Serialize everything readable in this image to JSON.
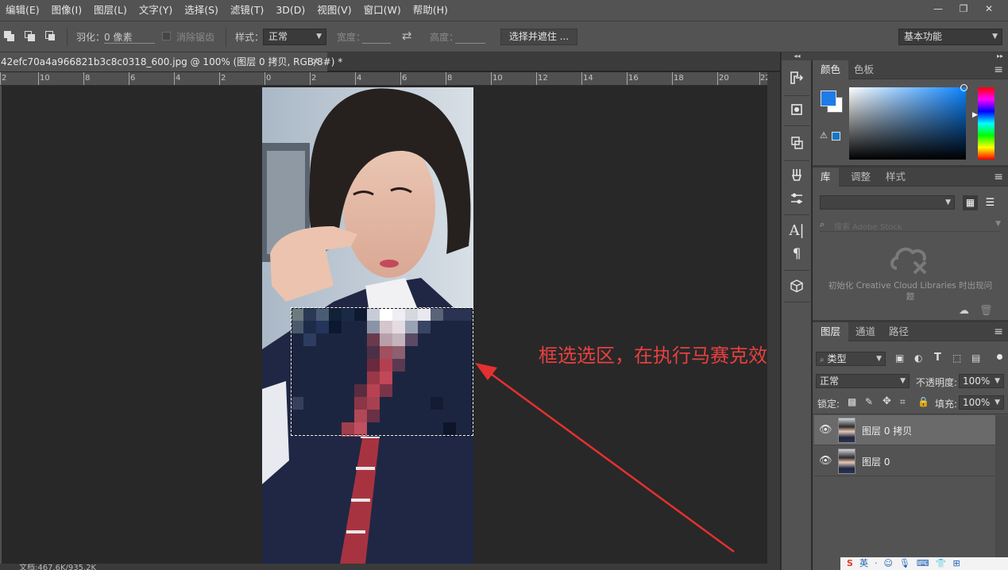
{
  "menubar": {
    "items": [
      "编辑(E)",
      "图像(I)",
      "图层(L)",
      "文字(Y)",
      "选择(S)",
      "滤镜(T)",
      "3D(D)",
      "视图(V)",
      "窗口(W)",
      "帮助(H)"
    ],
    "minimize": "—",
    "restore": "❐",
    "close": "✕"
  },
  "options": {
    "feather_label": "羽化：",
    "feather_value": "0 像素",
    "antialias_label": "消除锯齿",
    "style_label": "样式：",
    "style_value": "正常",
    "width_label": "宽度：",
    "swap_icon": "⇄",
    "height_label": "高度：",
    "select_mask_button": "选择并遮住 ...",
    "workspace_value": "基本功能"
  },
  "document": {
    "tab_title": "42efc70a4a966821b3c8c0318_600.jpg @ 100% (图层 0 拷贝, RGB/8#) *",
    "close": "✕",
    "ruler_numbers": [
      "2",
      "10",
      "8",
      "6",
      "4",
      "2",
      "0",
      "2",
      "4",
      "6",
      "8",
      "10",
      "12",
      "14",
      "16",
      "18",
      "20",
      "22"
    ],
    "annotation": "框选选区，在执行马赛克效果",
    "status_text": "文档:467.6K/935.2K"
  },
  "panels": {
    "collapse": "◂◂",
    "color_tabs": [
      "颜色",
      "色板"
    ],
    "library_tabs": [
      "库",
      "调整",
      "样式"
    ],
    "stock_placeholder": "搜索 Adobe Stock",
    "cc_message": "初始化 Creative Cloud Libraries 时出现问题",
    "layers_tabs": [
      "图层",
      "通道",
      "路径"
    ],
    "filter_type": "类型",
    "blend_mode": "正常",
    "opacity_label": "不透明度:",
    "opacity_value": "100%",
    "lock_label": "锁定:",
    "fill_label": "填充:",
    "fill_value": "100%",
    "layers": [
      {
        "name": "图层 0 拷贝",
        "selected": true
      },
      {
        "name": "图层 0",
        "selected": false
      }
    ]
  },
  "tray": {
    "items": [
      "S",
      "英",
      "·",
      "☺",
      "🎙",
      "⌨",
      "👕",
      "⊞"
    ]
  },
  "colors": {
    "foreground": "#1e7ce8",
    "background": "#ffffff",
    "annotation": "#e84040",
    "arrow": "#e53030"
  }
}
